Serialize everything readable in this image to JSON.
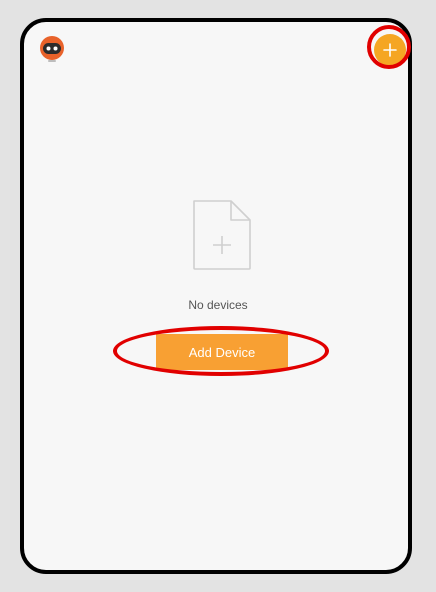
{
  "header": {
    "avatar_icon": "robot-avatar-icon",
    "add_icon": "plus-icon"
  },
  "empty_state": {
    "icon": "file-plus-icon",
    "message": "No devices"
  },
  "actions": {
    "add_device_label": "Add Device"
  },
  "colors": {
    "accent": "#f8a033",
    "highlight": "#e10000",
    "background": "#f7f7f7"
  }
}
